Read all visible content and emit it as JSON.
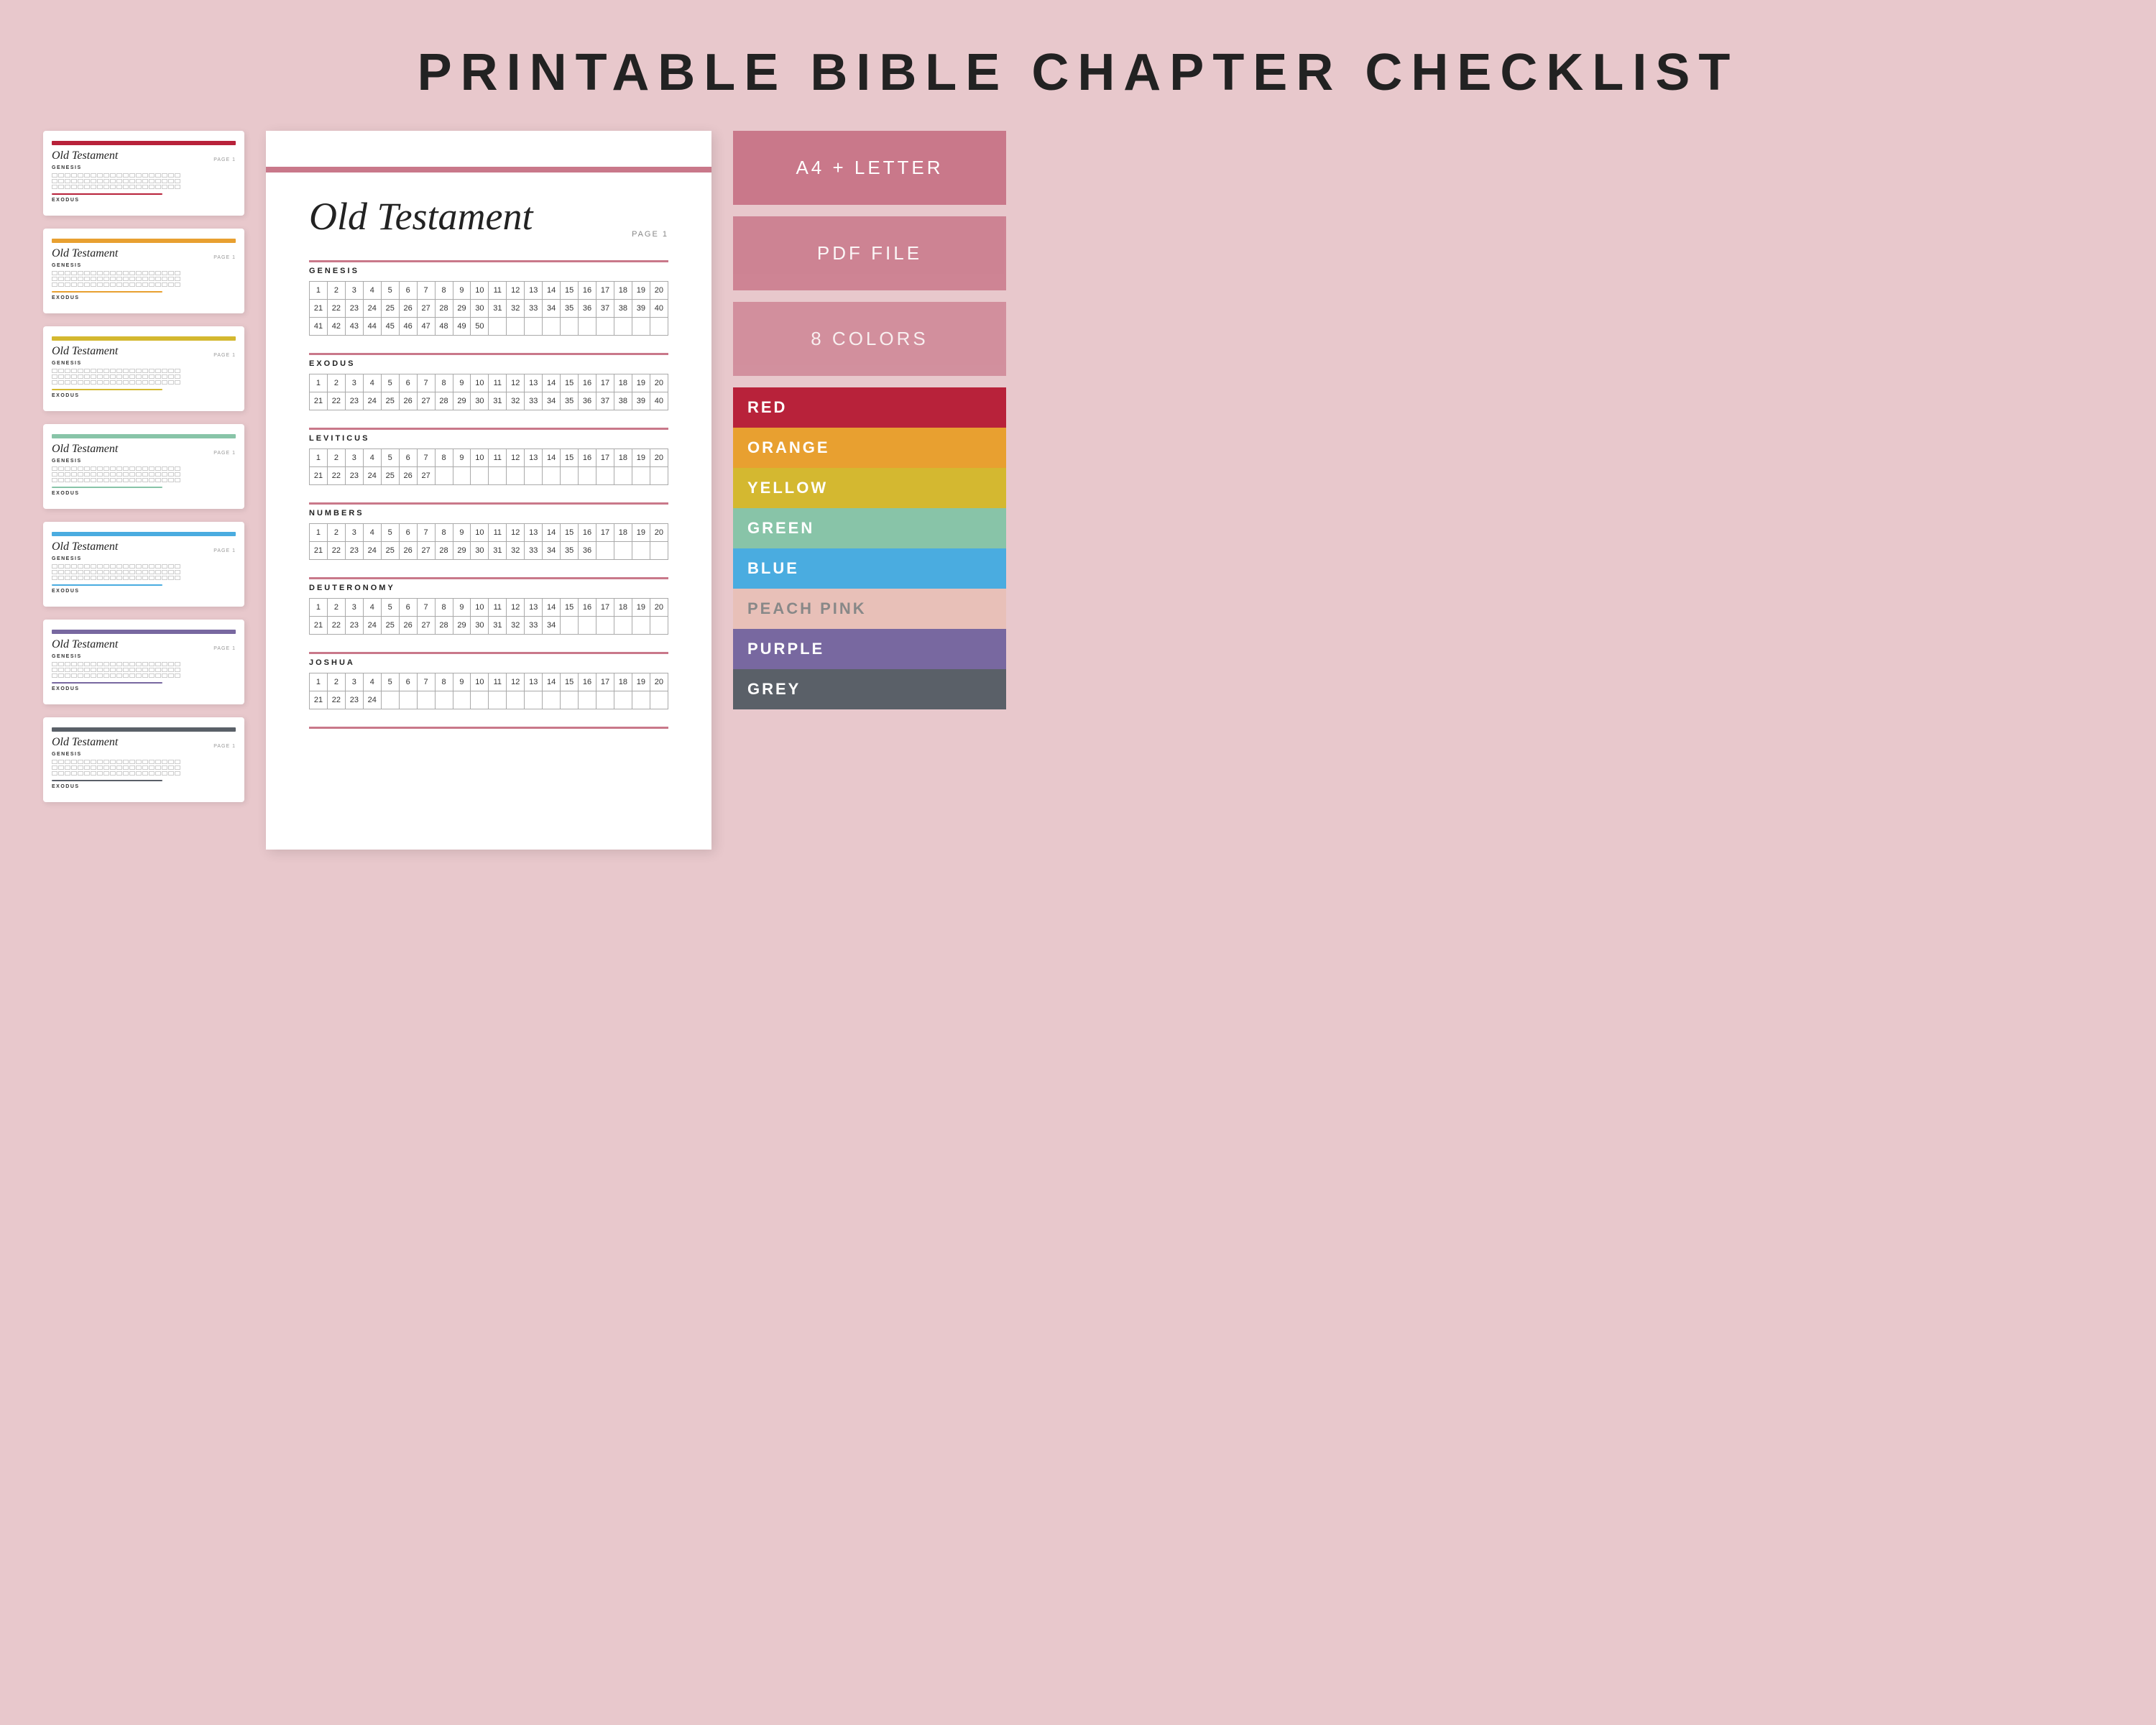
{
  "header": {
    "title_plain": "PRINTABLE ",
    "title_bold": "BIBLE CHAPTER CHECKLIST"
  },
  "thumbnails": [
    {
      "accent": "#b8223a",
      "underline": "#b8223a",
      "color_name": "red"
    },
    {
      "accent": "#e8a030",
      "underline": "#e8a030",
      "color_name": "orange"
    },
    {
      "accent": "#d4b830",
      "underline": "#d4b830",
      "color_name": "yellow"
    },
    {
      "accent": "#88c4a8",
      "underline": "#88c4a8",
      "color_name": "green"
    },
    {
      "accent": "#4aace0",
      "underline": "#4aace0",
      "color_name": "blue"
    },
    {
      "accent": "#7868a0",
      "underline": "#7868a0",
      "color_name": "purple"
    },
    {
      "accent": "#5a6068",
      "underline": "#5a6068",
      "color_name": "grey"
    }
  ],
  "preview": {
    "title": "Old Testament",
    "page_label": "PAGE 1",
    "top_bar_color": "#c9788a",
    "books": [
      {
        "name": "GENESIS",
        "rows": [
          [
            1,
            2,
            3,
            4,
            5,
            6,
            7,
            8,
            9,
            10,
            11,
            12,
            13,
            14,
            15,
            16,
            17,
            18,
            19,
            20
          ],
          [
            21,
            22,
            23,
            24,
            25,
            26,
            27,
            28,
            29,
            30,
            31,
            32,
            33,
            34,
            35,
            36,
            37,
            38,
            39,
            40
          ],
          [
            41,
            42,
            43,
            44,
            45,
            46,
            47,
            48,
            49,
            50,
            "",
            "",
            "",
            "",
            "",
            "",
            "",
            "",
            "",
            ""
          ]
        ]
      },
      {
        "name": "EXODUS",
        "rows": [
          [
            1,
            2,
            3,
            4,
            5,
            6,
            7,
            8,
            9,
            10,
            11,
            12,
            13,
            14,
            15,
            16,
            17,
            18,
            19,
            20
          ],
          [
            21,
            22,
            23,
            24,
            25,
            26,
            27,
            28,
            29,
            30,
            31,
            32,
            33,
            34,
            35,
            36,
            37,
            38,
            39,
            40
          ]
        ]
      },
      {
        "name": "LEVITICUS",
        "rows": [
          [
            1,
            2,
            3,
            4,
            5,
            6,
            7,
            8,
            9,
            10,
            11,
            12,
            13,
            14,
            15,
            16,
            17,
            18,
            19,
            20
          ],
          [
            21,
            22,
            23,
            24,
            25,
            26,
            27,
            "",
            "",
            "",
            "",
            "",
            "",
            "",
            "",
            "",
            "",
            "",
            "",
            ""
          ]
        ]
      },
      {
        "name": "NUMBERS",
        "rows": [
          [
            1,
            2,
            3,
            4,
            5,
            6,
            7,
            8,
            9,
            10,
            11,
            12,
            13,
            14,
            15,
            16,
            17,
            18,
            19,
            20
          ],
          [
            21,
            22,
            23,
            24,
            25,
            26,
            27,
            28,
            29,
            30,
            31,
            32,
            33,
            34,
            35,
            36,
            "",
            "",
            "",
            ""
          ]
        ]
      },
      {
        "name": "DEUTERONOMY",
        "rows": [
          [
            1,
            2,
            3,
            4,
            5,
            6,
            7,
            8,
            9,
            10,
            11,
            12,
            13,
            14,
            15,
            16,
            17,
            18,
            19,
            20
          ],
          [
            21,
            22,
            23,
            24,
            25,
            26,
            27,
            28,
            29,
            30,
            31,
            32,
            33,
            34,
            "",
            "",
            "",
            "",
            "",
            ""
          ]
        ]
      },
      {
        "name": "JOSHUA",
        "rows": [
          [
            1,
            2,
            3,
            4,
            5,
            6,
            7,
            8,
            9,
            10,
            11,
            12,
            13,
            14,
            15,
            16,
            17,
            18,
            19,
            20
          ],
          [
            21,
            22,
            23,
            24,
            "",
            "",
            "",
            "",
            "",
            "",
            "",
            "",
            "",
            "",
            "",
            "",
            "",
            "",
            "",
            ""
          ]
        ]
      }
    ]
  },
  "right_sidebar": {
    "a4_label": "A4 + LETTER",
    "pdf_label": "PDF FILE",
    "colors_label": "8 COLORS",
    "color_swatches": [
      {
        "name": "RED",
        "class": "color-red"
      },
      {
        "name": "ORANGE",
        "class": "color-orange"
      },
      {
        "name": "YELLOW",
        "class": "color-yellow"
      },
      {
        "name": "GREEN",
        "class": "color-green"
      },
      {
        "name": "BLUE",
        "class": "color-blue"
      },
      {
        "name": "PEACH PINK",
        "class": "color-peach"
      },
      {
        "name": "PURPLE",
        "class": "color-purple"
      },
      {
        "name": "GREY",
        "class": "color-grey"
      }
    ]
  }
}
